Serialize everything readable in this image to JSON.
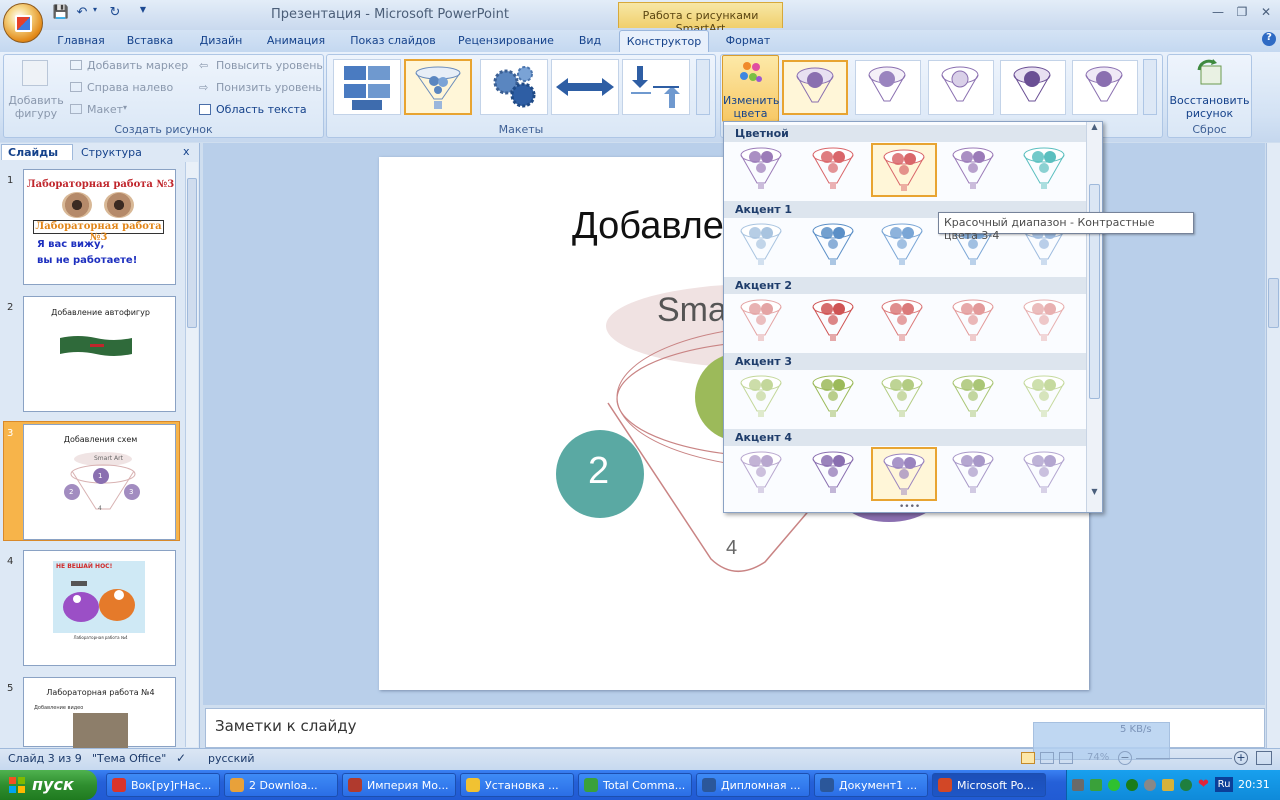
{
  "titlebar": {
    "title": "Презентация - Microsoft PowerPoint",
    "context_title": "Работа с рисунками SmartArt"
  },
  "tabs": [
    "Главная",
    "Вставка",
    "Дизайн",
    "Анимация",
    "Показ слайдов",
    "Рецензирование",
    "Вид",
    "Конструктор",
    "Формат"
  ],
  "active_tab": "Конструктор",
  "ribbon": {
    "create": {
      "add_shape": "Добавить фигуру",
      "add_bullet": "Добавить маркер",
      "right_to_left": "Справа налево",
      "layout": "Макет",
      "promote": "Повысить уровень",
      "demote": "Понизить уровень",
      "text_pane": "Область текста",
      "label": "Создать рисунок"
    },
    "layouts_label": "Макеты",
    "change_colors": "Изменить цвета",
    "reset_graphic": "Восстановить рисунок",
    "reset_label": "Сброс"
  },
  "slides_pane": {
    "tab_slides": "Слайды",
    "tab_outline": "Структура",
    "close": "x",
    "slides": [
      {
        "num": "1",
        "title": "Лабораторная работа №3",
        "subtitle": "Лабораторная работа №3",
        "line1": "Я вас вижу,",
        "line2": "вы не работаете!"
      },
      {
        "num": "2",
        "title": "Добавление автофигур"
      },
      {
        "num": "3",
        "title": "Добавления схем",
        "smartart": "Smart Art",
        "n1": "1",
        "n2": "2",
        "n3": "3",
        "n4": "4"
      },
      {
        "num": "4",
        "title": "НЕ ВЕШАЙ НОС!",
        "caption": "Лабораторная работа №4"
      },
      {
        "num": "5",
        "title": "Лабораторная работа №4",
        "bullet": "Добавление видео"
      }
    ]
  },
  "slide": {
    "title": "Добавле",
    "smartart_text": "Sma",
    "num2": "2",
    "num4": "4"
  },
  "gallery": {
    "sections": [
      {
        "name": "Цветной",
        "colors": [
          "#9b7bb8",
          "#d9666a",
          "#d9666a",
          "#9b7bb8",
          "#5bbfbf"
        ]
      },
      {
        "name": "Акцент 1",
        "colors": [
          "#a9c4e0",
          "#5b8fc7",
          "#7aa6d6",
          "#7aa6d6",
          "#9dbbdf"
        ]
      },
      {
        "name": "Акцент 2",
        "colors": [
          "#e4a4a4",
          "#cf5454",
          "#db7a7a",
          "#e39a9a",
          "#e8b0b0"
        ]
      },
      {
        "name": "Акцент 3",
        "colors": [
          "#c3d79a",
          "#9cba5a",
          "#b3cc82",
          "#aac676",
          "#c6da9f"
        ]
      },
      {
        "name": "Акцент 4",
        "colors": [
          "#b8a7cf",
          "#8a6fb0",
          "#9a84bf",
          "#a898c8",
          "#b3a6d0"
        ]
      }
    ],
    "tooltip": "Красочный диапазон - Контрастные цвета 3-4"
  },
  "notes_placeholder": "Заметки к слайду",
  "status": {
    "slide_info": "Слайд 3 из 9",
    "theme": "\"Тема Office\"",
    "language": "русский",
    "zoom": "74%",
    "net_speed": "5 KB/s"
  },
  "taskbar": {
    "start": "пуск",
    "tasks": [
      "Вок[ру]гНас...",
      "2 Downloa...",
      "Империя Мо...",
      "Установка ...",
      "Total Comma...",
      "Дипломная ...",
      "Документ1 ...",
      "Microsoft Po..."
    ],
    "clock": "20:31",
    "lang": "Ru"
  },
  "colors": {
    "accent": "#e8a431",
    "purple": "#8a6fb0",
    "teal": "#5aa9a3",
    "green": "#9cba5a"
  }
}
